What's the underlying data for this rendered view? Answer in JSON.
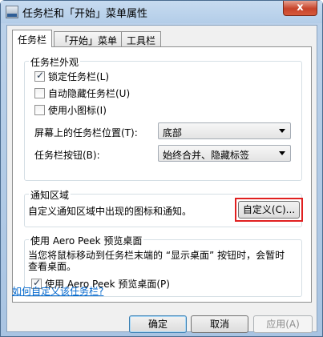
{
  "window": {
    "title": "任务栏和「开始」菜单属性",
    "close_label": "x"
  },
  "tabs": [
    {
      "label": "任务栏"
    },
    {
      "label": "「开始」菜单"
    },
    {
      "label": "工具栏"
    }
  ],
  "appearance": {
    "title": "任务栏外观",
    "lock_taskbar": {
      "label": "锁定任务栏(L)",
      "checked": true
    },
    "auto_hide": {
      "label": "自动隐藏任务栏(U)",
      "checked": false
    },
    "small_icons": {
      "label": "使用小图标(I)",
      "checked": false
    },
    "location_label": "屏幕上的任务栏位置(T):",
    "location_value": "底部",
    "buttons_label": "任务栏按钮(B):",
    "buttons_value": "始终合并、隐藏标签"
  },
  "notification": {
    "title": "通知区域",
    "description": "自定义通知区域中出现的图标和通知。",
    "customize_button": "自定义(C)..."
  },
  "aero_peek": {
    "title": "使用 Aero Peek 预览桌面",
    "description_line1": "当您将鼠标移动到任务栏末端的 “显示桌面” 按钮时，会暂时",
    "description_line2": "查看桌面。",
    "checkbox": {
      "label": "使用 Aero Peek 预览桌面(P)",
      "checked": true
    }
  },
  "help_link": "如何自定义该任务栏?",
  "footer": {
    "ok": "确定",
    "cancel": "取消",
    "apply": "应用(A)"
  },
  "colors": {
    "highlight": "#e02020",
    "link": "#0066cc"
  }
}
